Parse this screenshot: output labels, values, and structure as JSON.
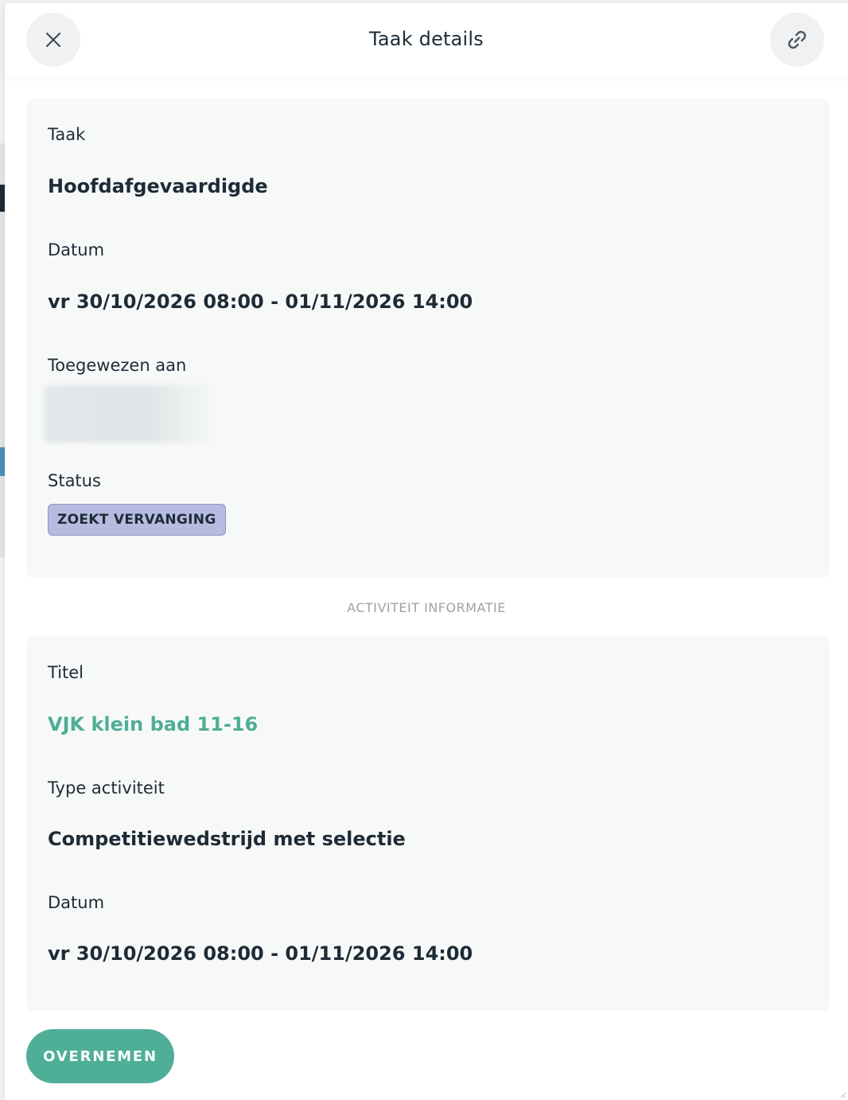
{
  "header": {
    "title": "Taak details",
    "close_icon": "close-icon",
    "link_icon": "link-icon"
  },
  "task": {
    "task_label": "Taak",
    "task_value": "Hoofdafgevaardigde",
    "date_label": "Datum",
    "date_value": "vr 30/10/2026 08:00 - 01/11/2026 14:00",
    "assigned_label": "Toegewezen aan",
    "status_label": "Status",
    "status_value": "ZOEKT VERVANGING"
  },
  "activity_section_title": "ACTIVITEIT INFORMATIE",
  "activity": {
    "title_label": "Titel",
    "title_value": "VJK klein bad 11-16",
    "type_label": "Type activiteit",
    "type_value": "Competitiewedstrijd met selectie",
    "date_label": "Datum",
    "date_value": "vr 30/10/2026 08:00 - 01/11/2026 14:00"
  },
  "actions": {
    "take_over_label": "OVERNEMEN"
  },
  "colors": {
    "accent": "#4fae97",
    "status_badge_bg": "#b6bbe0",
    "status_badge_border": "#8e95c9",
    "text": "#1d2b36",
    "card_bg": "#f7f9f9"
  }
}
